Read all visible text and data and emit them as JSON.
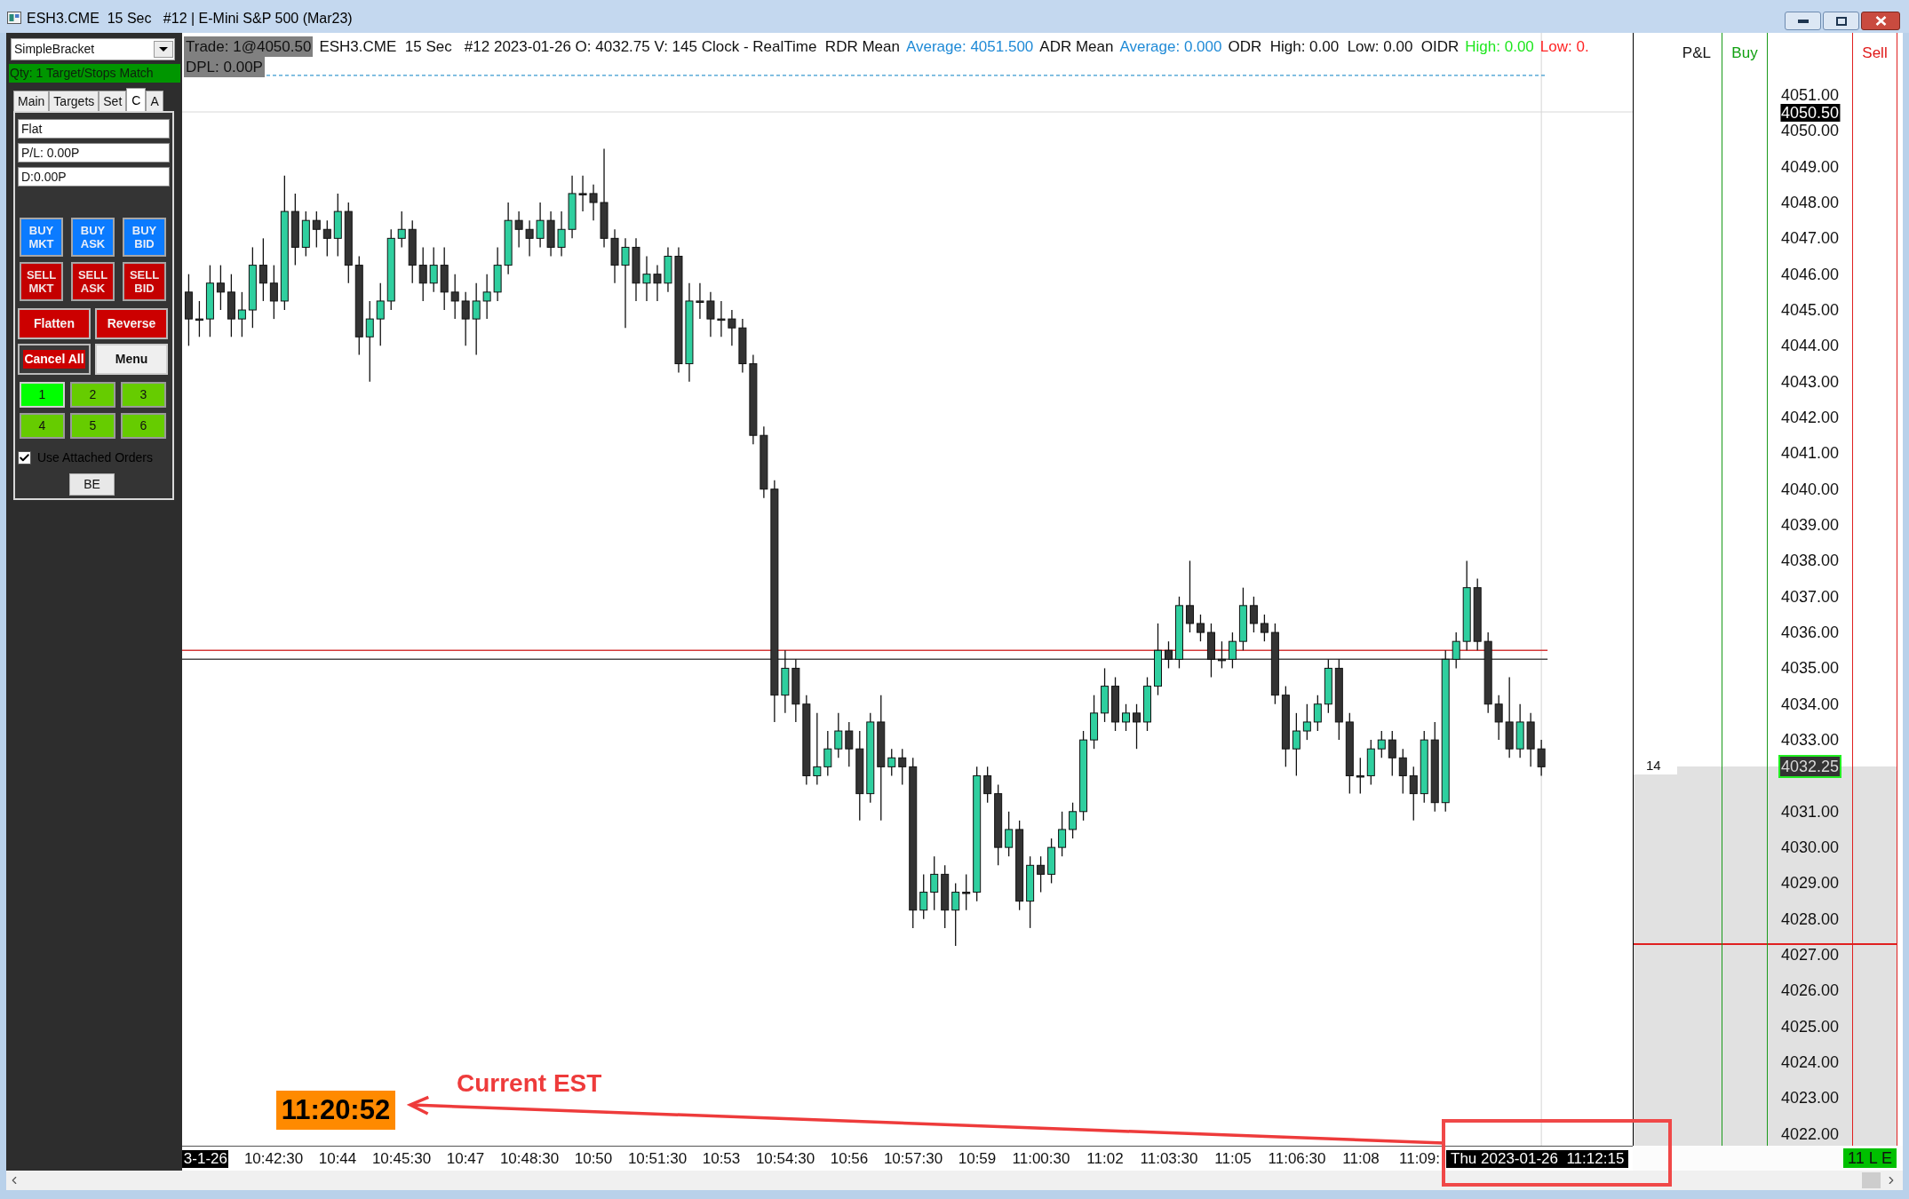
{
  "window": {
    "title": "ESH3.CME  15 Sec   #12 | E-Mini S&P 500 (Mar23)"
  },
  "trade_panel": {
    "strategy": "SimpleBracket",
    "status": "Qty: 1 Target/Stops Match",
    "tabs": [
      {
        "label": "Main",
        "selected": false
      },
      {
        "label": "Targets",
        "selected": false
      },
      {
        "label": "Set",
        "selected": false
      },
      {
        "label": "C",
        "selected": true
      },
      {
        "label": "A",
        "selected": false
      }
    ],
    "readouts": [
      "Flat",
      "P/L: 0.00P",
      "D:0.00P"
    ],
    "order_buttons": [
      {
        "label": "BUY MKT",
        "kind": "buy"
      },
      {
        "label": "BUY ASK",
        "kind": "buy"
      },
      {
        "label": "BUY BID",
        "kind": "buy"
      },
      {
        "label": "SELL MKT",
        "kind": "sell"
      },
      {
        "label": "SELL ASK",
        "kind": "sell"
      },
      {
        "label": "SELL BID",
        "kind": "sell"
      }
    ],
    "action_buttons": [
      {
        "label": "Flatten",
        "kind": "danger"
      },
      {
        "label": "Reverse",
        "kind": "danger"
      },
      {
        "label": "Cancel All",
        "kind": "cancel"
      },
      {
        "label": "Menu",
        "kind": "plain"
      }
    ],
    "quantity_presets": [
      {
        "label": "1",
        "selected": true
      },
      {
        "label": "2",
        "selected": false
      },
      {
        "label": "3",
        "selected": false
      },
      {
        "label": "4",
        "selected": false
      },
      {
        "label": "5",
        "selected": false
      },
      {
        "label": "6",
        "selected": false
      }
    ],
    "attached_orders": {
      "label": "Use Attached Orders",
      "checked": true
    },
    "be_button": "BE"
  },
  "chart": {
    "info_line": [
      {
        "text": "Trade: 1@4050.50",
        "kind": "highlight"
      },
      {
        "text": "ESH3.CME  15 Sec   #12 2023-01-26 O: 4032.75 V: 145 Clock - RealTime  RDR Mean",
        "kind": "plain"
      },
      {
        "text": "Average: 4051.500",
        "kind": "average"
      },
      {
        "text": "ADR Mean",
        "kind": "plain"
      },
      {
        "text": "Average: 0.000",
        "kind": "average"
      },
      {
        "text": "ODR  High: 0.00  Low: 0.00  OIDR",
        "kind": "plain"
      },
      {
        "text": "High: 0.00",
        "kind": "high"
      },
      {
        "text": "Low: 0.",
        "kind": "low"
      }
    ],
    "pl_line": {
      "text": "DPL: 0.00P",
      "kind": "highlight"
    },
    "time_axis": {
      "start_label": "3-1-26",
      "labels": [
        "10:42:30",
        "10:44",
        "10:45:30",
        "10:47",
        "10:48:30",
        "10:50",
        "10:51:30",
        "10:53",
        "10:54:30",
        "10:56",
        "10:57:30",
        "10:59",
        "11:00:30",
        "11:02",
        "11:03:30",
        "11:05",
        "11:06:30",
        "11:08",
        "11:09:"
      ],
      "cursor_label": "Thu 2023-01-26  11:12:15"
    }
  },
  "dom": {
    "headers": {
      "pl": "P&L",
      "buy": "Buy",
      "sell": "Sell"
    },
    "trade_marker": "4050.50",
    "prices_above": [
      "4051.00",
      "4050.00",
      "4049.00",
      "4048.00",
      "4047.00",
      "4046.00",
      "4045.00",
      "4044.00",
      "4043.00",
      "4042.00",
      "4041.00",
      "4040.00",
      "4039.00",
      "4038.00",
      "4037.00",
      "4036.00",
      "4035.00",
      "4034.00",
      "4033.00"
    ],
    "last_price": "4032.25",
    "prices_below": [
      "4031.00",
      "4030.00",
      "4029.00",
      "4028.00",
      "4027.00",
      "4026.00",
      "4025.00",
      "4024.00",
      "4023.00",
      "4022.00"
    ],
    "volume_marker": "14",
    "status_badge": "11 L E"
  },
  "annotations": {
    "clock": "11:20:52",
    "caption": "Current EST"
  }
}
